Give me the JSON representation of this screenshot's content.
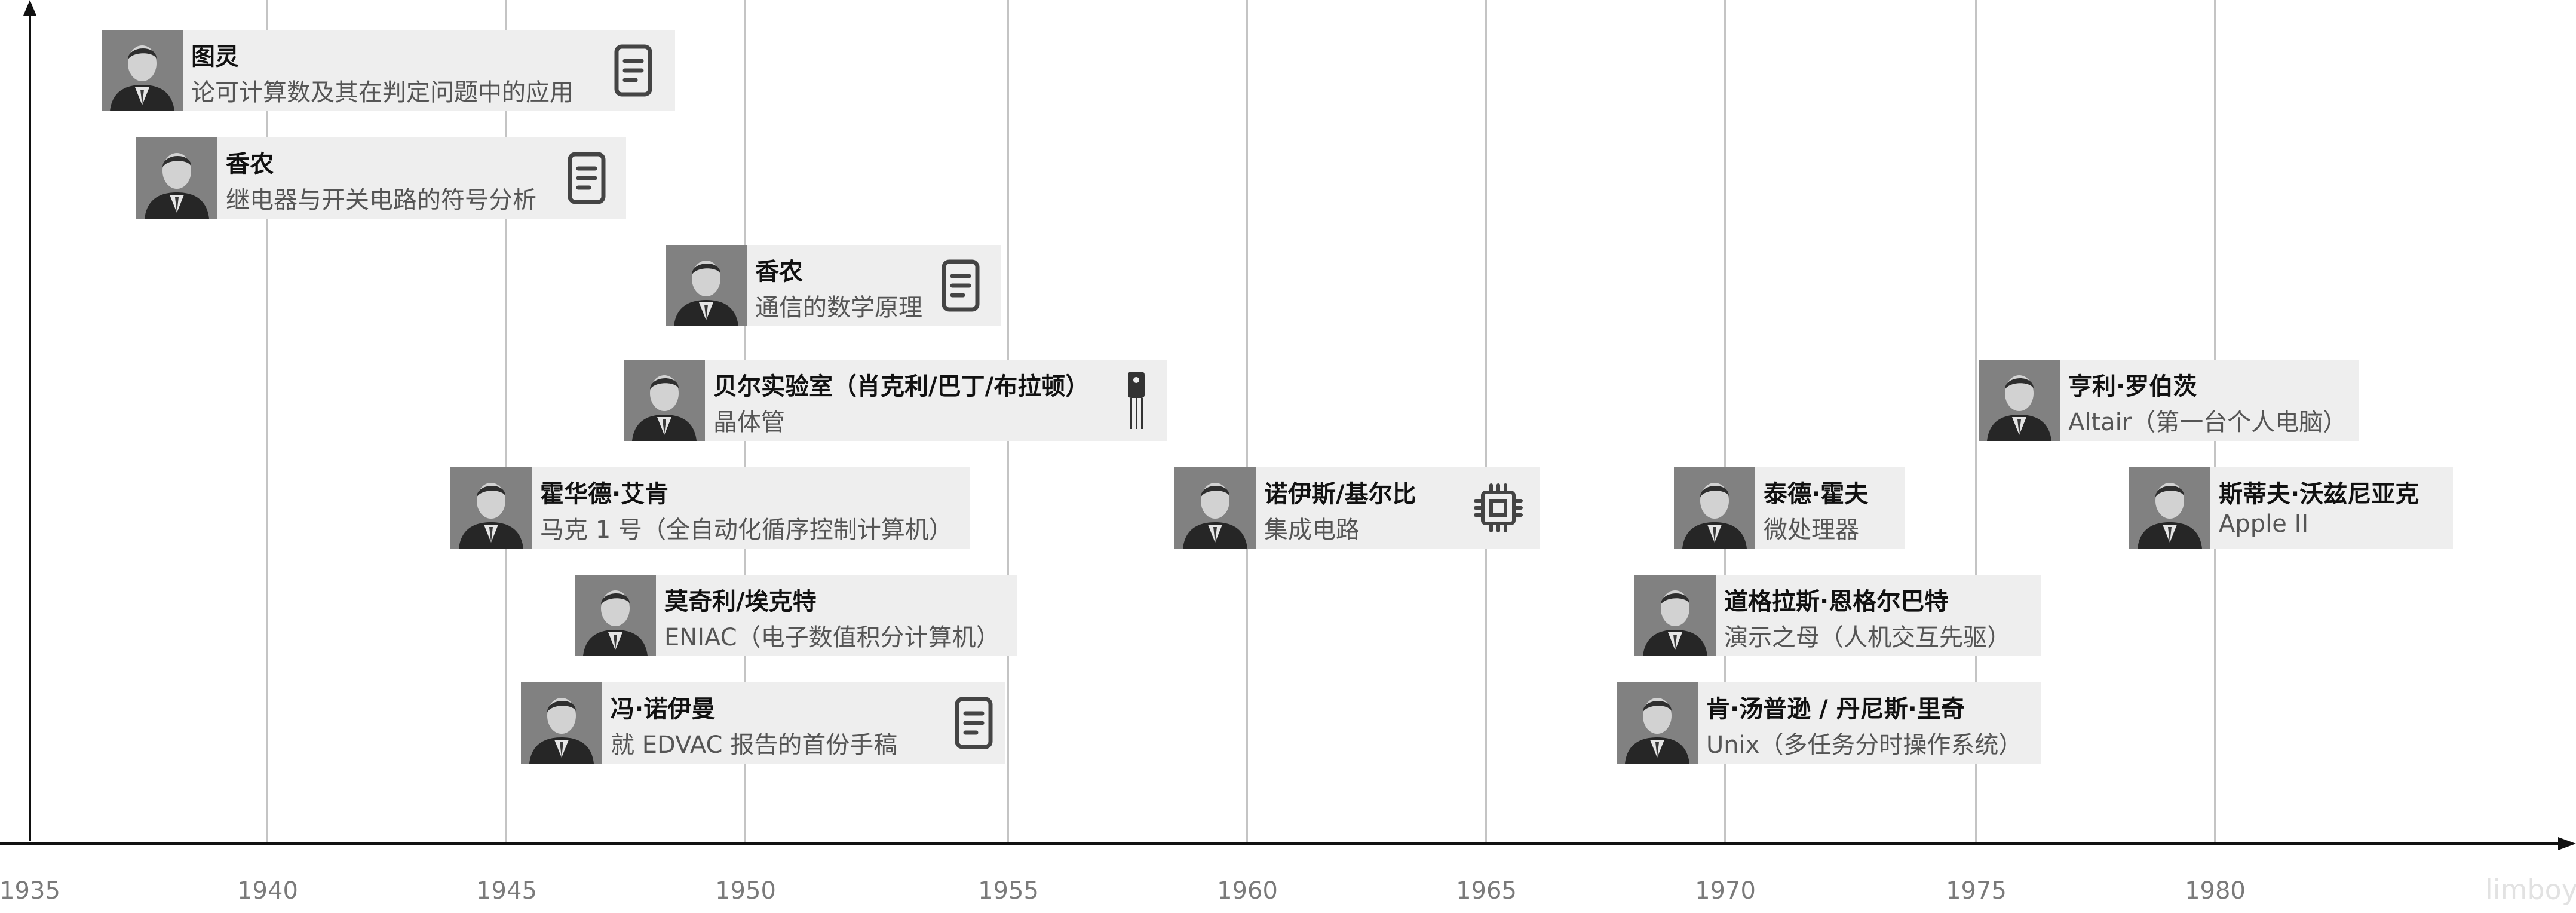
{
  "axis": {
    "ticks": [
      "1935",
      "1940",
      "1945",
      "1950",
      "1955",
      "1960",
      "1965",
      "1970",
      "1975",
      "1980"
    ]
  },
  "watermark": "limboy",
  "events": [
    {
      "person": "图灵",
      "work": "论可计算数及其在判定问题中的应用",
      "icon": "document-icon"
    },
    {
      "person": "香农",
      "work": "继电器与开关电路的符号分析",
      "icon": "document-icon"
    },
    {
      "person": "香农",
      "work": "通信的数学原理",
      "icon": "document-icon"
    },
    {
      "person": "贝尔实验室（肖克利/巴丁/布拉顿）",
      "work": "晶体管",
      "icon": "transistor-icon"
    },
    {
      "person": "霍华德·艾肯",
      "work": "马克 1 号（全自动化循序控制计算机）",
      "icon": ""
    },
    {
      "person": "莫奇利/埃克特",
      "work": "ENIAC（电子数值积分计算机）",
      "icon": ""
    },
    {
      "person": "冯·诺伊曼",
      "work": "就 EDVAC 报告的首份手稿",
      "icon": "document-icon"
    },
    {
      "person": "诺伊斯/基尔比",
      "work": "集成电路",
      "icon": "chip-icon"
    },
    {
      "person": "泰德·霍夫",
      "work": "微处理器",
      "icon": ""
    },
    {
      "person": "道格拉斯·恩格尔巴特",
      "work": "演示之母（人机交互先驱）",
      "icon": ""
    },
    {
      "person": "肯·汤普逊 / 丹尼斯·里奇",
      "work": "Unix（多任务分时操作系统）",
      "icon": ""
    },
    {
      "person": "亨利·罗伯茨",
      "work": "Altair（第一台个人电脑）",
      "icon": ""
    },
    {
      "person": "斯蒂夫·沃兹尼亚克",
      "work": "Apple II",
      "icon": ""
    }
  ]
}
